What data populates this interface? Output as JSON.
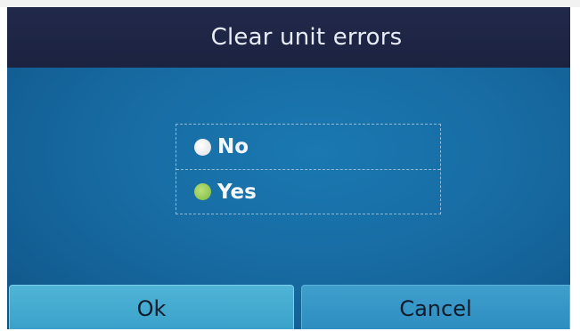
{
  "dialog": {
    "title": "Clear unit errors"
  },
  "options": [
    {
      "label": "No",
      "selected": false
    },
    {
      "label": "Yes",
      "selected": true
    }
  ],
  "buttons": {
    "ok_label": "Ok",
    "cancel_label": "Cancel"
  },
  "colors": {
    "screen_bg": "#176ca3",
    "title_bar_bg": "#1f2645",
    "radio_unselected": "#e6e8ec",
    "radio_selected": "#8fc651",
    "ok_button": "#44aad0",
    "cancel_button": "#3596c6"
  }
}
